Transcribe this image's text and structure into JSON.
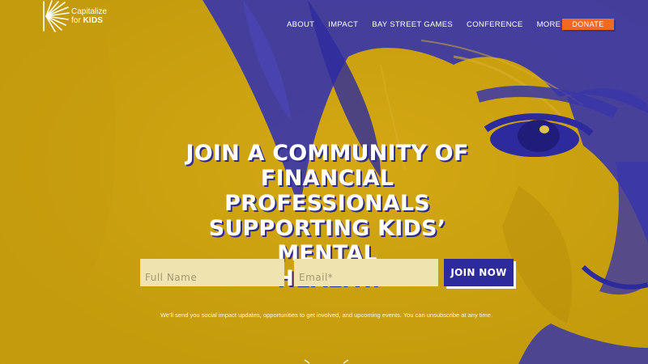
{
  "brand": {
    "line1": "Capitalize",
    "line2_prefix": "for",
    "line2_bold": "KIDS",
    "logo_icon": "sunburst-icon"
  },
  "nav": {
    "items": [
      {
        "label": "ABOUT"
      },
      {
        "label": "IMPACT"
      },
      {
        "label": "BAY STREET GAMES"
      },
      {
        "label": "CONFERENCE"
      },
      {
        "label": "MORE",
        "icon": "chevron-down-icon"
      }
    ],
    "donate_label": "DONATE"
  },
  "hero": {
    "heading_lines": [
      "JOIN A COMMUNITY OF",
      "FINANCIAL PROFESSIONALS",
      "SUPPORTING KIDS’ MENTAL",
      "HEALTH."
    ]
  },
  "form": {
    "name_placeholder": "Full Name",
    "email_placeholder": "Email*",
    "submit_label": "JOIN NOW",
    "disclaimer": "We’ll send you social impact updates, opportunities to get involved, and upcoming events. You can unsubscribe at any time."
  },
  "colors": {
    "background_yellow": "#caa20e",
    "duotone_blue": "#2d2a9e",
    "donate_orange": "#f26a21",
    "field_cream": "#efe3b0"
  }
}
